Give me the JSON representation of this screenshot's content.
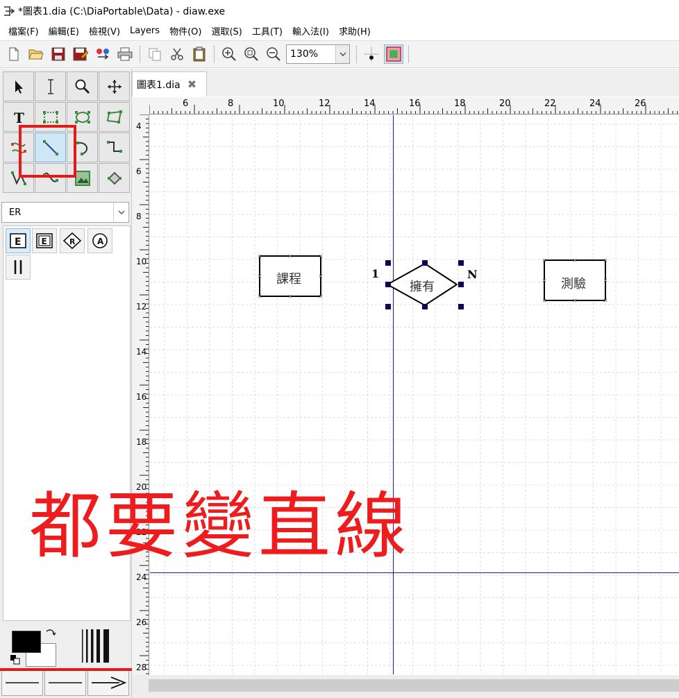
{
  "window": {
    "title": "*圖表1.dia (C:\\DiaPortable\\Data) - diaw.exe"
  },
  "menu": [
    "檔案(F)",
    "編輯(E)",
    "檢視(V)",
    "Layers",
    "物件(O)",
    "選取(S)",
    "工具(T)",
    "輸入法(I)",
    "求助(H)"
  ],
  "toolbar": {
    "zoom": "130%"
  },
  "sheet": {
    "selected": "ER"
  },
  "tab": {
    "label": "圖表1.dia",
    "close": "✖"
  },
  "ruler": {
    "top": [
      "6",
      "8",
      "10",
      "12",
      "14",
      "16",
      "18",
      "20",
      "22",
      "24",
      "26"
    ],
    "left": [
      "4",
      "6",
      "8",
      "10",
      "12",
      "14",
      "16",
      "18",
      "20",
      "22",
      "24",
      "26",
      "28"
    ]
  },
  "diagram": {
    "entity1": "課程",
    "relationship": "擁有",
    "entity2": "測驗",
    "card_left": "1",
    "card_right": "N"
  },
  "annotation": {
    "note": "都要變直線"
  },
  "colors": {
    "accent": "#e21a1a",
    "guide": "#1a1aa0",
    "handle": "#0a0a50",
    "grid": "#dcdcdc"
  }
}
